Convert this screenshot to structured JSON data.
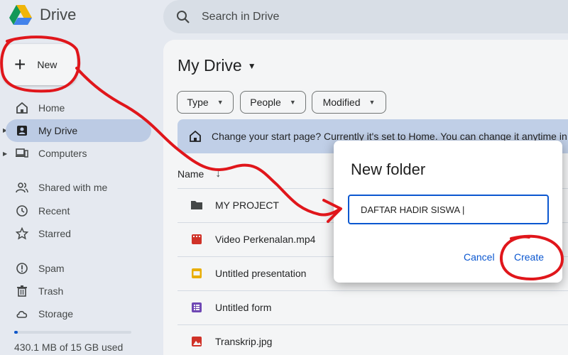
{
  "app": {
    "name": "Drive"
  },
  "search": {
    "placeholder": "Search in Drive"
  },
  "sidebar": {
    "new_label": "New",
    "items": [
      {
        "label": "Home",
        "icon": "home-icon"
      },
      {
        "label": "My Drive",
        "icon": "my-drive-icon"
      },
      {
        "label": "Computers",
        "icon": "computers-icon"
      },
      {
        "label": "Shared with me",
        "icon": "shared-icon"
      },
      {
        "label": "Recent",
        "icon": "clock-icon"
      },
      {
        "label": "Starred",
        "icon": "star-icon"
      },
      {
        "label": "Spam",
        "icon": "spam-icon"
      },
      {
        "label": "Trash",
        "icon": "trash-icon"
      },
      {
        "label": "Storage",
        "icon": "cloud-icon"
      }
    ],
    "storage_text": "430.1 MB of 15 GB used",
    "storage_used_fraction": 0.03
  },
  "main": {
    "title": "My Drive",
    "filters": [
      "Type",
      "People",
      "Modified"
    ],
    "banner": "Change your start page? Currently it's set to Home. You can change it anytime in Se",
    "column_name": "Name",
    "files": [
      {
        "name": "MY PROJECT",
        "icon": "folder-icon",
        "color": "#444746"
      },
      {
        "name": "Video Perkenalan.mp4",
        "icon": "video-icon",
        "color": "#d93025"
      },
      {
        "name": "Untitled presentation",
        "icon": "slides-icon",
        "color": "#f4b400"
      },
      {
        "name": "Untitled form",
        "icon": "forms-icon",
        "color": "#7248b9"
      },
      {
        "name": "Transkrip.jpg",
        "icon": "image-icon",
        "color": "#d93025"
      }
    ]
  },
  "dialog": {
    "title": "New folder",
    "input_value": "DAFTAR HADIR SISWA |",
    "cancel_label": "Cancel",
    "create_label": "Create"
  },
  "colors": {
    "accent": "#0b57d0",
    "annotation": "#e0161b"
  }
}
